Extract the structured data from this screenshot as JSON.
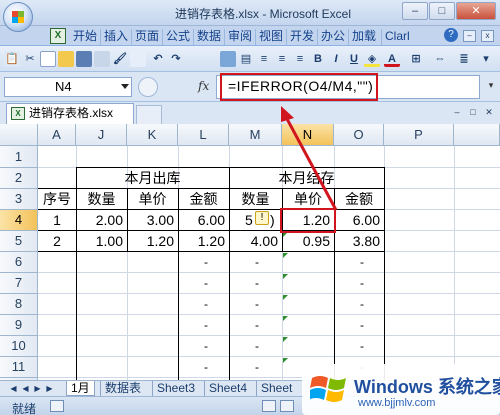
{
  "window": {
    "title": "进销存表格.xlsx - Microsoft Excel",
    "controls": [
      "–",
      "□",
      "✕"
    ]
  },
  "ribbon": {
    "tabs": [
      "开始",
      "插入",
      "页面",
      "公式",
      "数据",
      "审阅",
      "视图",
      "开发",
      "办公",
      "加载",
      "Clarl"
    ]
  },
  "formula_bar": {
    "name_box": "N4",
    "fx": "fx",
    "formula": "=IFERROR(O4/M4,\"\")"
  },
  "workbook_tab": "进销存表格.xlsx",
  "columns": [
    "A",
    "J",
    "K",
    "L",
    "M",
    "N",
    "O",
    "P"
  ],
  "rows": [
    "1",
    "2",
    "3",
    "4",
    "5",
    "6",
    "7",
    "8",
    "9",
    "10",
    "11",
    "12"
  ],
  "cells": {
    "header_out": "本月出库",
    "header_stock": "本月结存",
    "seq": "序号",
    "qty1": "数量",
    "price1": "单价",
    "amt1": "金额",
    "qty2": "数量",
    "price2": "单价",
    "amt2": "金额",
    "r4": [
      "1",
      "2.00",
      "3.00",
      "6.00",
      "5",
      "1.20",
      "6.00"
    ],
    "r5": [
      "2",
      "1.00",
      "1.20",
      "1.20",
      "4.00",
      "0.95",
      "3.80"
    ],
    "dash": "-"
  },
  "sheets": [
    "1月",
    "数据表",
    "Sheet3",
    "Sheet4",
    "Sheet"
  ],
  "status": {
    "ready": "就绪"
  },
  "watermark": {
    "brand": "Windows 系统之家",
    "url": "www.bjjmlv.com"
  },
  "colors": {
    "highlight": "#d0151e",
    "ribbon": "#c3d5ee",
    "accent": "#15428b"
  }
}
